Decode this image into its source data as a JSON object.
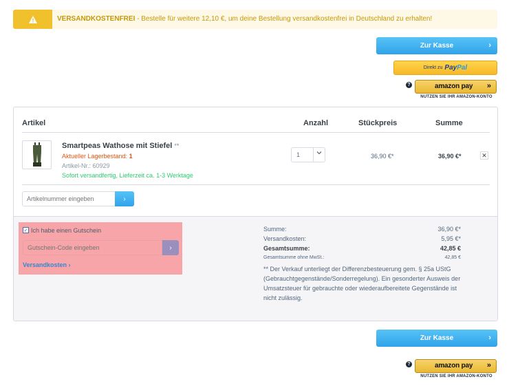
{
  "notice": {
    "highlight": "VERSANDKOSTENFREI",
    "message": " - Bestelle für weitere 12,10 €, um deine Bestellung versandkostenfrei in Deutschland zu erhalten!"
  },
  "checkout": {
    "kasse_label": "Zur Kasse",
    "paypal_prefix": "Direkt zu",
    "paypal_pay": "Pay",
    "paypal_pal": "Pal",
    "amazon_help": "?",
    "amazon_logo": "amazon pay",
    "amazon_arrows": "»",
    "amazon_tag": "NUTZEN SIE IHR AMAZON-KONTO"
  },
  "table": {
    "col_article": "Artikel",
    "col_qty": "Anzahl",
    "col_unit": "Stückpreis",
    "col_total": "Summe"
  },
  "item": {
    "name": "Smartpeas Wathose mit Stiefel",
    "stars": "**",
    "stock_label": "Aktueller Lagerbestand:",
    "stock_value": "1",
    "article_number": "Artikel-Nr.: 60929",
    "shipping": "Sofort versandfertig, Lieferzeit ca. 1-3 Werktage",
    "qty": "1",
    "unit_price": "36,90 €*",
    "total_price": "36,90 €*",
    "remove": "✕"
  },
  "article_input": {
    "placeholder": "Artikelnummer eingeben"
  },
  "voucher": {
    "checkbox_label": "Ich habe einen Gutschein",
    "checked": true,
    "placeholder": "Gutschein-Code eingeben",
    "shipping_link": "Versandkosten"
  },
  "summary": {
    "sum_label": "Summe:",
    "sum_value": "36,90 €*",
    "shipping_label": "Versandkosten:",
    "shipping_value": "5,95 €*",
    "grand_label": "Gesamtsumme:",
    "grand_value": "42,85 €",
    "net_label": "Gesamtsumme ohne MwSt.:",
    "net_value": "42,85 €",
    "note": "**  Der Verkauf unterliegt der Differenzbesteuerung gem. § 25a UStG (Gebrauchtgegenstände/Sonderregelung). Ein gesonderter Ausweis der Umsatzsteuer für gebrauchte oder wiederaufbereitete Gegenstände ist nicht zulässig."
  },
  "colors": {
    "accent_blue": "#31a3ea",
    "warning_yellow": "#f0c12c",
    "stock_orange": "#e1540f",
    "in_stock_green": "#2ecc71",
    "voucher_highlight": "#f8a5a9"
  }
}
